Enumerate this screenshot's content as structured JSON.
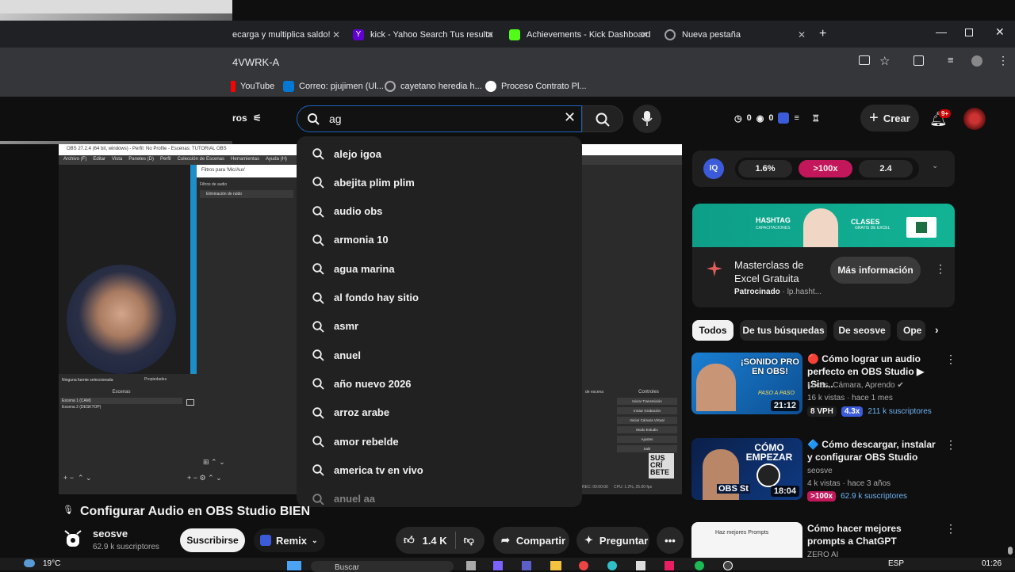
{
  "tabs": [
    {
      "label": "ecarga y multiplica saldo!",
      "favicon_color": "#202124"
    },
    {
      "label": "kick - Yahoo Search Tus resulta",
      "favicon_color": "#6001d2"
    },
    {
      "label": "Achievements - Kick Dashboard",
      "favicon_color": "#53fc18"
    },
    {
      "label": "Nueva pestaña",
      "favicon_color": "#9aa0a6"
    }
  ],
  "address_fragment": "4VWRK-A",
  "bookmarks": [
    "YouTube",
    "Correo: pjujimen (Ul...",
    "cayetano heredia h...",
    "Proceso Contrato Pl..."
  ],
  "header": {
    "filters_label": "ros",
    "search_value": "ag",
    "stats": [
      "0",
      "0"
    ],
    "create_label": "Crear",
    "notif_badge": "9+"
  },
  "suggestions": [
    "alejo igoa",
    "abejita plim plim",
    "audio obs",
    "armonia 10",
    "agua marina",
    "al fondo hay sitio",
    "asmr",
    "anuel",
    "año nuevo 2026",
    "arroz arabe",
    "amor rebelde",
    "america tv en vivo",
    "anuel aa"
  ],
  "obs": {
    "window_title": "OBS 27.2.4 (64 bit, windows) - Perfil: No Profile - Escenas: TUTORIAL OBS",
    "menu": [
      "Archivo (F)",
      "Editar",
      "Vista",
      "Paneles (D)",
      "Perfil",
      "Colección de Escenas",
      "Herramientas",
      "Ayuda (H)"
    ],
    "filters_title": "Filtros para 'Mic/Aux'",
    "filters_header": "Filtros de audio",
    "filter_item": "Eliminación de ruido",
    "no_source": "Ninguna fuente seleccionada",
    "properties": "Propiedades",
    "scenes_header": "Escenas",
    "scenes": [
      "Escena 1 (CAM)",
      "Escena 2 (DESKTOP)"
    ],
    "controls_header": "Controles",
    "controls": [
      "Iniciar Transmisión",
      "Iniciar Grabación",
      "Iniciar Cámara Virtual",
      "Modo Estudio",
      "Ajustes",
      "Salir"
    ],
    "transitions_label": "de escena",
    "status": "CPU: 1.2%, 25.00 fps",
    "status_time": "REC: 00:00:00",
    "subscribe_overlay": "SUS\nCRÍ\nBETE"
  },
  "video": {
    "title": "Configurar Audio en OBS Studio BIEN",
    "channel": "seosve",
    "subscribers": "62.9 k suscriptores",
    "subscribe_label": "Suscribirse",
    "remix_label": "Remix",
    "likes": "1.4 K",
    "share_label": "Compartir",
    "ask_label": "Preguntar"
  },
  "sidebar": {
    "iq_stats": [
      "1.6%",
      ">100x",
      "2.4"
    ],
    "ad": {
      "banner_brand": "HASHTAG",
      "banner_brand_sub": "CAPACITACIONES",
      "banner_text": "CLASES",
      "banner_text_sub": "GRATIS DE EXCEL",
      "title": "Masterclass de Excel Gratuita",
      "sponsor": "Patrocinado",
      "domain": "lp.hasht...",
      "cta": "Más información"
    },
    "chips": [
      "Todos",
      "De tus búsquedas",
      "De seosve",
      "Ope"
    ],
    "recommendations": [
      {
        "title": "🔴 Cómo lograr un audio perfecto en OBS Studio ▶ ¡Sin...",
        "channel": "Luces, Cámara, Aprendo",
        "stats": "16 k vistas · hace 1 mes",
        "vph": "8 VPH",
        "multiplier": "4.3x",
        "subs": "211 k suscriptores",
        "duration": "21:12",
        "thumb_text": "¡SONIDO PRO EN OBS!",
        "thumb_sub": "PASO A PASO"
      },
      {
        "title": "🔷 Cómo descargar, instalar y configurar OBS Studio",
        "channel": "seosve",
        "stats": "4 k vistas · hace 3 años",
        "multiplier": ">100x",
        "subs": "62.9 k suscriptores",
        "duration": "18:04",
        "thumb_text": "CÓMO EMPEZAR",
        "thumb_sub": "OBS St"
      },
      {
        "title": "Cómo hacer mejores prompts a ChatGPT",
        "channel": "ZERO AI",
        "thumb_text": "Haz mejores Prompts"
      }
    ]
  },
  "taskbar": {
    "temp": "19°C",
    "search": "Buscar",
    "lang": "ESP",
    "time": "01:26"
  }
}
